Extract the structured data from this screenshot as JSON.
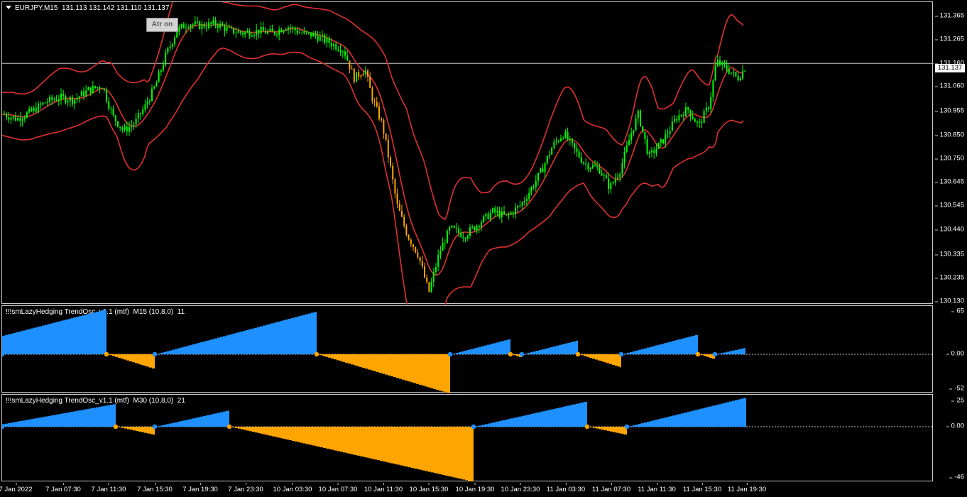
{
  "main": {
    "symbol": "EURJPY,M15",
    "ohlc": "131.113 131.142 131.110 131.137",
    "current_price": "131.137",
    "atr_button": "Atr on",
    "price_ticks": [
      "131.365",
      "131.265",
      "131.160",
      "131.060",
      "130.955",
      "130.850",
      "130.750",
      "130.645",
      "130.545",
      "130.440",
      "130.335",
      "130.235",
      "130.130"
    ]
  },
  "osc1": {
    "title": "!!!smLazyHedging TrendOsc_v1.1 (mtf)  M15 (10,8,0)  11",
    "ticks": [
      "65",
      "0.00",
      "-52"
    ]
  },
  "osc2": {
    "title": "!!!smLazyHedging TrendOsc_v1.1 (mtf)  M30 (10,8,0)  21",
    "ticks": [
      "25",
      "0.00",
      "-46"
    ]
  },
  "time_labels": [
    "7 Jan 2022",
    "7 Jan 07:30",
    "7 Jan 11:30",
    "7 Jan 15:30",
    "7 Jan 19:30",
    "7 Jan 23:30",
    "10 Jan 03:30",
    "10 Jan 07:30",
    "10 Jan 11:30",
    "10 Jan 15:30",
    "10 Jan 19:30",
    "10 Jan 23:30",
    "11 Jan 03:30",
    "11 Jan 07:30",
    "11 Jan 11:30",
    "11 Jan 15:30",
    "11 Jan 19:30"
  ],
  "colors": {
    "bull": "#00ff00",
    "bear": "#ffa500",
    "band": "#e03030",
    "osc_up": "#1e90ff",
    "osc_down": "#ffa500"
  },
  "chart_data": {
    "type": "line",
    "title": "EURJPY,M15",
    "ylim": [
      130.13,
      131.4
    ],
    "close_path": [
      [
        0,
        130.93
      ],
      [
        20,
        130.91
      ],
      [
        40,
        130.94
      ],
      [
        60,
        130.98
      ],
      [
        80,
        131.0
      ],
      [
        100,
        130.99
      ],
      [
        120,
        131.03
      ],
      [
        140,
        131.05
      ],
      [
        155,
        130.92
      ],
      [
        170,
        130.86
      ],
      [
        185,
        130.89
      ],
      [
        200,
        130.96
      ],
      [
        215,
        131.05
      ],
      [
        230,
        131.18
      ],
      [
        245,
        131.28
      ],
      [
        260,
        131.31
      ],
      [
        280,
        131.3
      ],
      [
        300,
        131.31
      ],
      [
        320,
        131.28
      ],
      [
        340,
        131.27
      ],
      [
        360,
        131.28
      ],
      [
        380,
        131.27
      ],
      [
        400,
        131.3
      ],
      [
        420,
        131.27
      ],
      [
        440,
        131.26
      ],
      [
        460,
        131.23
      ],
      [
        480,
        131.2
      ],
      [
        495,
        131.08
      ],
      [
        510,
        131.12
      ],
      [
        520,
        131.0
      ],
      [
        535,
        130.88
      ],
      [
        545,
        130.72
      ],
      [
        555,
        130.55
      ],
      [
        570,
        130.42
      ],
      [
        585,
        130.34
      ],
      [
        600,
        130.18
      ],
      [
        615,
        130.35
      ],
      [
        630,
        130.45
      ],
      [
        650,
        130.42
      ],
      [
        670,
        130.47
      ],
      [
        690,
        130.52
      ],
      [
        710,
        130.5
      ],
      [
        730,
        130.55
      ],
      [
        745,
        130.62
      ],
      [
        760,
        130.7
      ],
      [
        775,
        130.8
      ],
      [
        790,
        130.85
      ],
      [
        805,
        130.78
      ],
      [
        820,
        130.72
      ],
      [
        840,
        130.7
      ],
      [
        855,
        130.62
      ],
      [
        870,
        130.7
      ],
      [
        885,
        130.85
      ],
      [
        895,
        130.93
      ],
      [
        910,
        130.75
      ],
      [
        930,
        130.82
      ],
      [
        950,
        130.92
      ],
      [
        965,
        130.95
      ],
      [
        980,
        130.88
      ],
      [
        995,
        130.97
      ],
      [
        1005,
        131.15
      ],
      [
        1020,
        131.12
      ],
      [
        1035,
        131.08
      ],
      [
        1048,
        131.137
      ]
    ]
  }
}
